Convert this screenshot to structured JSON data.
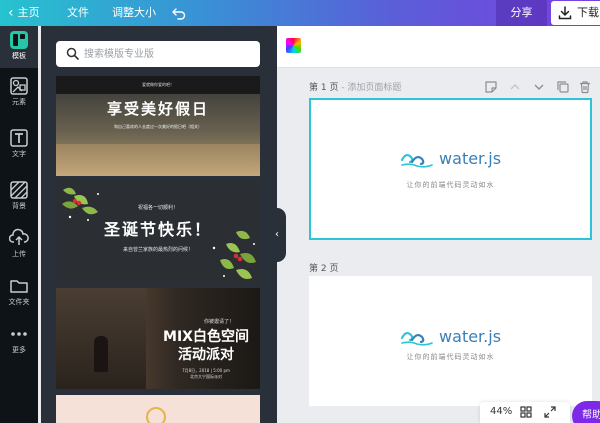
{
  "topbar": {
    "back_label": "主页",
    "file_label": "文件",
    "resize_label": "调整大小",
    "share_label": "分享",
    "download_label": "下载"
  },
  "rail": {
    "items": [
      {
        "label": "模板",
        "icon": "template-icon"
      },
      {
        "label": "元素",
        "icon": "elements-icon"
      },
      {
        "label": "文字",
        "icon": "text-icon"
      },
      {
        "label": "背景",
        "icon": "background-icon"
      },
      {
        "label": "上传",
        "icon": "upload-icon"
      },
      {
        "label": "文件夹",
        "icon": "folder-icon"
      },
      {
        "label": "更多",
        "icon": "more-icon"
      }
    ]
  },
  "search": {
    "placeholder": "搜索模版专业版"
  },
  "templates": [
    {
      "fine_top": "爱就做你爱的吧！",
      "title": "享受美好假日",
      "subtitle": "和自己喜欢的人去度过一次美好的假日吧（相关）"
    },
    {
      "fine_top": "祝福各一切顺利！",
      "title": "圣诞节快乐！",
      "subtitle": "来自曾兰家族的最热烈的问候！"
    },
    {
      "fine_top": "你被邀请了！",
      "title_line1": "MIX白色空间",
      "title_line2": "活动派对",
      "detail_line1": "7月8日，2018 | 5:00 pm",
      "detail_line2": "北京大宁国际派对"
    }
  ],
  "editor": {
    "pages": [
      {
        "label": "第 1 页",
        "title_placeholder": "- 添加页面标题",
        "logo_text": "water.js",
        "tagline": "让你的前端代码灵动如水"
      },
      {
        "label": "第 2 页",
        "logo_text": "water.js",
        "tagline": "让你的前端代码灵动如水"
      }
    ],
    "zoom": "44%",
    "help_label": "帮助"
  },
  "colors": {
    "accent_teal": "#2ec4d6",
    "help_purple": "#7d2ae8",
    "logo_blue": "#3a7fb8"
  }
}
